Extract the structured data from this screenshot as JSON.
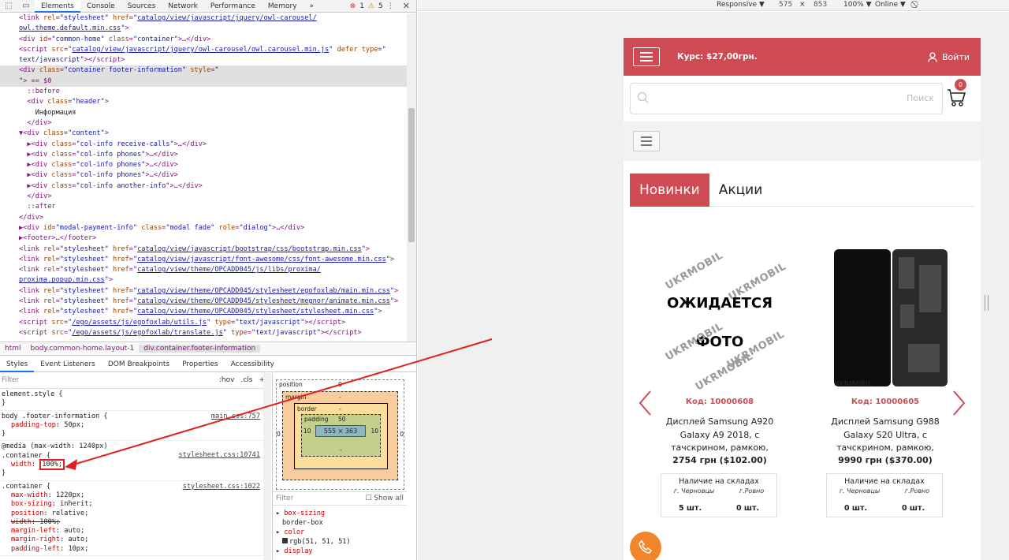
{
  "devtools": {
    "tabs": [
      "Elements",
      "Console",
      "Sources",
      "Network",
      "Performance",
      "Memory"
    ],
    "more": "»",
    "errors": "1",
    "warnings": "5",
    "dom_lines": [
      {
        "html": "<span>&lt;link </span><span class='a'>rel</span>=<span class='v'>\"stylesheet\"</span> <span class='a'>href</span>=<span class='v'>\"</span><span class='lnk'>catalog/view/javascript/jquery/owl-carousel/</span>"
      },
      {
        "html": "<span class='lnk'>owl.theme.default.min.css</span><span class='v'>\"</span>&gt;"
      },
      {
        "html": "&lt;div <span class='a'>id</span>=<span class='v'>\"common-home\"</span> <span class='a'>class</span>=<span class='v'>\"container\"</span>&gt;…&lt;/div&gt;"
      },
      {
        "html": "&lt;script <span class='a'>src</span>=<span class='v'>\"</span><span class='lnk'>catalog/view/javascript/jquery/owl-carousel/owl.carousel.min.js</span><span class='v'>\"</span> <span class='a'>defer</span> <span class='a'>type</span>=<span class='v'>\"</span>"
      },
      {
        "html": "<span class='v'>text/javascript\"</span>&gt;&lt;/script&gt;"
      },
      {
        "html": "&lt;div <span class='a'>class</span>=<span class='v'>\"container footer-information\"</span> <span class='a'>style</span>=<span class='v'>\"</span>",
        "sel": true
      },
      {
        "html": "<span class='v'>\"</span>&gt; == $0",
        "sel": true
      },
      {
        "html": "&nbsp;&nbsp;::before"
      },
      {
        "html": "&nbsp;&nbsp;&lt;div <span class='a'>class</span>=<span class='v'>\"header\"</span>&gt;"
      },
      {
        "html": "&nbsp;&nbsp;&nbsp;&nbsp;<span class='t'>Информация</span>"
      },
      {
        "html": "&nbsp;&nbsp;&lt;/div&gt;"
      },
      {
        "html": "▼&lt;div <span class='a'>class</span>=<span class='v'>\"content\"</span>&gt;"
      },
      {
        "html": "&nbsp;&nbsp;▶&lt;div <span class='a'>class</span>=<span class='v'>\"col-info receive-calls\"</span>&gt;…&lt;/div&gt;"
      },
      {
        "html": "&nbsp;&nbsp;▶&lt;div <span class='a'>class</span>=<span class='v'>\"col-info phones\"</span>&gt;…&lt;/div&gt;"
      },
      {
        "html": "&nbsp;&nbsp;▶&lt;div <span class='a'>class</span>=<span class='v'>\"col-info phones\"</span>&gt;…&lt;/div&gt;"
      },
      {
        "html": "&nbsp;&nbsp;▶&lt;div <span class='a'>class</span>=<span class='v'>\"col-info phones\"</span>&gt;…&lt;/div&gt;"
      },
      {
        "html": "&nbsp;&nbsp;▶&lt;div <span class='a'>class</span>=<span class='v'>\"col-info another-info\"</span>&gt;…&lt;/div&gt;"
      },
      {
        "html": "&nbsp;&nbsp;&lt;/div&gt;"
      },
      {
        "html": "&nbsp;&nbsp;::after"
      },
      {
        "html": "&lt;/div&gt;"
      },
      {
        "html": "▶&lt;div <span class='a'>id</span>=<span class='v'>\"modal-payment-info\"</span> <span class='a'>class</span>=<span class='v'>\"modal fade\"</span> <span class='a'>role</span>=<span class='v'>\"dialog\"</span>&gt;…&lt;/div&gt;"
      },
      {
        "html": "▶&lt;footer&gt;…&lt;/footer&gt;"
      },
      {
        "html": "&lt;link <span class='a'>rel</span>=<span class='v'>\"stylesheet\"</span> <span class='a'>href</span>=<span class='v'>\"</span><span class='lnk'>catalog/view/javascript/bootstrap/css/bootstrap.min.css</span><span class='v'>\"</span>&gt;"
      },
      {
        "html": "&lt;link <span class='a'>rel</span>=<span class='v'>\"stylesheet\"</span> <span class='a'>href</span>=<span class='v'>\"</span><span class='lnk'>catalog/view/javascript/font-awesome/css/font-awesome.min.css</span><span class='v'>\"</span>&gt;"
      },
      {
        "html": "&lt;link <span class='a'>rel</span>=<span class='v'>\"stylesheet\"</span> <span class='a'>href</span>=<span class='v'>\"</span><span class='lnk'>catalog/view/theme/OPCADD045/js/libs/proxima/</span>"
      },
      {
        "html": "<span class='lnk'>proxima.popup.min.css</span><span class='v'>\"</span>&gt;"
      },
      {
        "html": "&lt;link <span class='a'>rel</span>=<span class='v'>\"stylesheet\"</span> <span class='a'>href</span>=<span class='v'>\"</span><span class='lnk'>catalog/view/theme/OPCADD045/stylesheet/egofoxlab/main.min.css</span><span class='v'>\"</span>&gt;"
      },
      {
        "html": "&lt;link <span class='a'>rel</span>=<span class='v'>\"stylesheet\"</span> <span class='a'>href</span>=<span class='v'>\"</span><span class='lnk'>catalog/view/theme/OPCADD045/stylesheet/megnor/animate.min.css</span><span class='v'>\"</span>&gt;"
      },
      {
        "html": "&lt;link <span class='a'>rel</span>=<span class='v'>\"stylesheet\"</span> <span class='a'>href</span>=<span class='v'>\"</span><span class='lnk'>catalog/view/theme/OPCADD045/stylesheet/stylesheet.min.css</span><span class='v'>\"</span>&gt;"
      },
      {
        "html": "&lt;script <span class='a'>src</span>=<span class='v'>\"</span><span class='lnk'>/ego/assets/js/egofoxlab/utils.js</span><span class='v'>\"</span> <span class='a'>type</span>=<span class='v'>\"text/javascript\"</span>&gt;&lt;/script&gt;"
      },
      {
        "html": "&lt;script <span class='a'>src</span>=<span class='v'>\"</span><span class='lnk'>/ego/assets/js/egofoxlab/translate.js</span><span class='v'>\"</span> <span class='a'>type</span>=<span class='v'>\"text/javascript\"</span>&gt;&lt;/script&gt;"
      }
    ],
    "crumbs": [
      "html",
      "body.common-home.layout-1",
      "div.container.footer-information"
    ],
    "panel_tabs": [
      "Styles",
      "Event Listeners",
      "DOM Breakpoints",
      "Properties",
      "Accessibility"
    ],
    "filter_placeholder": "Filter",
    "hov": ":hov",
    "cls": ".cls",
    "plus": "+",
    "rules": {
      "element_style": "element.style {",
      "close": "}",
      "r1_sel": "body .footer-information {",
      "r1_src": "main.css:757",
      "r1_prop": "padding-top",
      "r1_val": "50px;",
      "media": "@media (max-width: 1240px)",
      "r2_sel": ".container {",
      "r2_src": "stylesheet.css:10741",
      "r2_prop": "width",
      "r2_val": "100%;",
      "r3_sel": ".container {",
      "r3_src": "stylesheet.css:1022",
      "r3_props": [
        {
          "k": "max-width",
          "v": "1220px;"
        },
        {
          "k": "box-sizing",
          "v": "inherit;"
        },
        {
          "k": "position",
          "v": "relative;"
        },
        {
          "k": "width",
          "v": "100%;",
          "strike": true
        },
        {
          "k": "margin-left",
          "v": "auto;"
        },
        {
          "k": "margin-right",
          "v": "auto;"
        },
        {
          "k": "padding-left",
          "v": "10px;"
        }
      ]
    },
    "boxmodel": {
      "position": "position",
      "position_val": "0",
      "margin": "margin",
      "margin_val": "-",
      "border": "border",
      "border_val": "-",
      "padding": "padding",
      "padding_top": "50",
      "padding_side": "10",
      "padding_bottom": "-",
      "content": "555 × 363",
      "side_zero": "0"
    },
    "computed": {
      "filter": "Filter",
      "show_all": "Show all",
      "items": [
        {
          "k": "box-sizing",
          "v": "border-box"
        },
        {
          "k": "color",
          "v": "rgb(51, 51, 51)"
        },
        {
          "k": "display",
          "v": ""
        }
      ]
    }
  },
  "device_toolbar": {
    "mode": "Responsive ▼",
    "width": "575",
    "x": "×",
    "height": "853",
    "zoom": "100% ▼",
    "network": "Online ▼"
  },
  "site": {
    "rate": "Курс: $27,00грн.",
    "login": "Войти",
    "search_placeholder": "Поиск",
    "cart_count": "0",
    "tabs": [
      "Новинки",
      "Акции"
    ],
    "products": [
      {
        "pending_line1": "ОЖИДАЕТСЯ",
        "pending_line2": "ФОТО",
        "watermark": "UKRMOBIL",
        "code": "Код: 10000608",
        "name_lines": [
          "Дисплей Samsung A920",
          "Galaxy A9 2018, с",
          "тачскрином, рамкою,"
        ],
        "price": "2754 грн ($102.00)",
        "stock_head": "Наличие на складах",
        "city1": "г. Черновцы",
        "city2": "г.Ровно",
        "qty1": "5 шт.",
        "qty2": "0 шт."
      },
      {
        "brand": "UKRMOBIL",
        "code": "Код: 10000605",
        "name_lines": [
          "Дисплей Samsung G988",
          "Galaxy S20 Ultra, с",
          "тачскрином, рамкою,"
        ],
        "price": "9990 грн ($370.00)",
        "stock_head": "Наличие на складах",
        "city1": "г. Черновцы",
        "city2": "г.Ровно",
        "qty1": "0 шт.",
        "qty2": "0 шт."
      }
    ]
  },
  "colors": {
    "brand_red": "#ce4b54",
    "call_orange": "#f0862c",
    "annotation_red": "#e02020"
  }
}
